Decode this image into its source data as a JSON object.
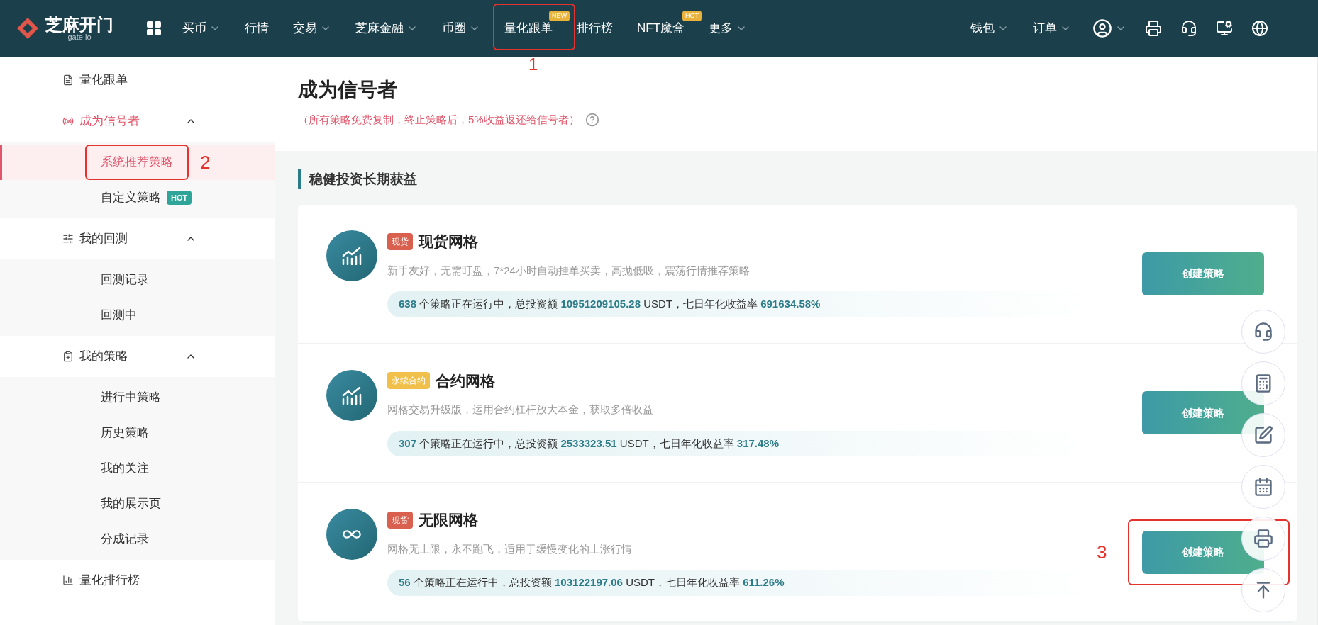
{
  "logo": {
    "name": "芝麻开门",
    "sub": "gate.io"
  },
  "nav": {
    "left": [
      {
        "label": "买币",
        "dropdown": true
      },
      {
        "label": "行情",
        "dropdown": false
      },
      {
        "label": "交易",
        "dropdown": true
      },
      {
        "label": "芝麻金融",
        "dropdown": true
      },
      {
        "label": "币圈",
        "dropdown": true
      },
      {
        "label": "量化跟单",
        "dropdown": false,
        "badge": "NEW",
        "annotation": "1"
      },
      {
        "label": "排行榜",
        "dropdown": false
      },
      {
        "label": "NFT魔盒",
        "dropdown": false,
        "badge": "HOT"
      },
      {
        "label": "更多",
        "dropdown": true
      }
    ],
    "right": [
      {
        "label": "钱包",
        "dropdown": true
      },
      {
        "label": "订单",
        "dropdown": true
      }
    ]
  },
  "sidebar": {
    "items": [
      {
        "label": "量化跟单",
        "selected": false
      },
      {
        "label": "成为信号者",
        "selected": true,
        "expanded": true,
        "children": [
          {
            "label": "系统推荐策略",
            "selected": true,
            "annotation": "2"
          },
          {
            "label": "自定义策略",
            "selected": false,
            "badge": "HOT"
          }
        ]
      },
      {
        "label": "我的回测",
        "selected": false,
        "expanded": true,
        "children": [
          {
            "label": "回测记录",
            "selected": false
          },
          {
            "label": "回测中",
            "selected": false
          }
        ]
      },
      {
        "label": "我的策略",
        "selected": false,
        "expanded": true,
        "children": [
          {
            "label": "进行中策略",
            "selected": false
          },
          {
            "label": "历史策略",
            "selected": false
          },
          {
            "label": "我的关注",
            "selected": false
          },
          {
            "label": "我的展示页",
            "selected": false
          },
          {
            "label": "分成记录",
            "selected": false
          }
        ]
      },
      {
        "label": "量化排行榜",
        "selected": false
      }
    ]
  },
  "page": {
    "title": "成为信号者",
    "subtitle": "（所有策略免费复制，终止策略后，5%收益返还给信号者）"
  },
  "section": {
    "title": "稳健投资长期获益",
    "cards": [
      {
        "kind": "grid",
        "tag": {
          "label": "现货",
          "color": "#d9604e"
        },
        "title": "现货网格",
        "description": "新手友好，无需盯盘，7*24小时自动挂单买卖，高抛低吸，震荡行情推荐策略",
        "stats": "**638** 个策略正在运行中，总投资额 **10951209105.28** USDT，七日年化收益率 **691634.58%**",
        "button": "创建策略"
      },
      {
        "kind": "grid",
        "tag": {
          "label": "永续合约",
          "color": "#f0c04a"
        },
        "title": "合约网格",
        "description": "网格交易升级版，运用合约杠杆放大本金，获取多倍收益",
        "stats": "**307** 个策略正在运行中，总投资额 **2533323.51** USDT，七日年化收益率 **317.48%**",
        "button": "创建策略"
      },
      {
        "kind": "infinite",
        "tag": {
          "label": "现货",
          "color": "#d9604e"
        },
        "title": "无限网格",
        "description": "网格无上限，永不跑飞，适用于缓慢变化的上涨行情",
        "stats": "**56** 个策略正在运行中，总投资额 **103122197.06** USDT，七日年化收益率 **611.26%**",
        "button": "创建策略",
        "annotation": "3"
      }
    ]
  }
}
